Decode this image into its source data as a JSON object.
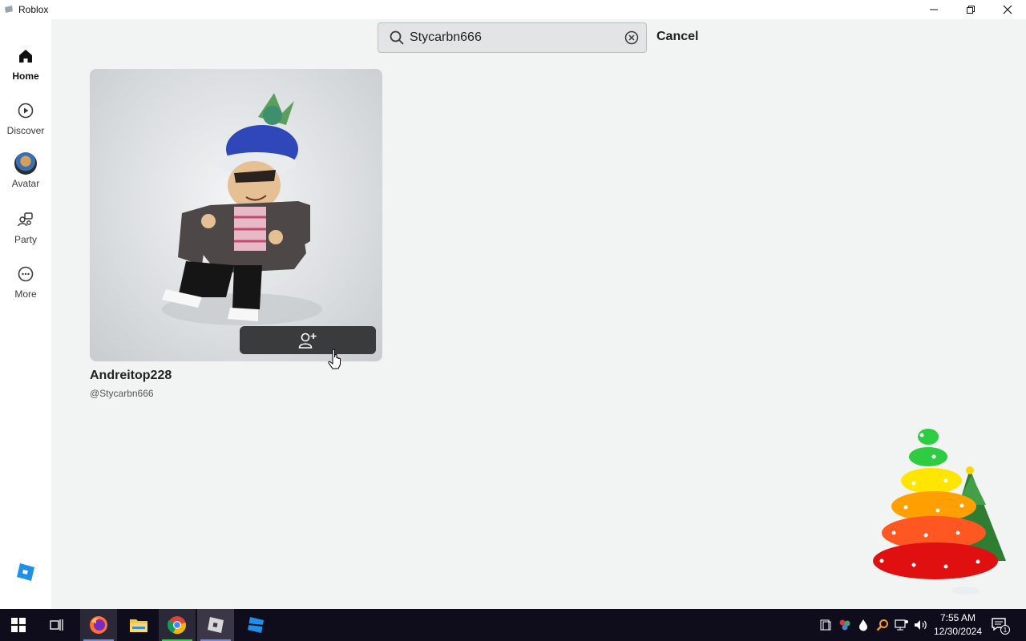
{
  "window": {
    "title": "Roblox",
    "controls": [
      "minimize",
      "restore",
      "close"
    ]
  },
  "sidebar": {
    "items": [
      {
        "label": "Home",
        "icon": "home-icon",
        "active": true
      },
      {
        "label": "Discover",
        "icon": "play-circle-icon",
        "active": false
      },
      {
        "label": "Avatar",
        "icon": "avatar-icon",
        "active": false
      },
      {
        "label": "Party",
        "icon": "party-icon",
        "active": false
      },
      {
        "label": "More",
        "icon": "more-icon",
        "active": false
      }
    ],
    "logo": "roblox-logo-icon"
  },
  "search": {
    "value": "Stycarbn666",
    "cancel_label": "Cancel"
  },
  "results": [
    {
      "display_name": "Andreitop228",
      "username": "@Stycarbn666",
      "action_icon": "add-friend-icon"
    }
  ],
  "taskbar": {
    "apps": [
      "windows-start-icon",
      "task-view-icon",
      "firefox-icon",
      "file-explorer-icon",
      "chrome-icon",
      "roblox-icon",
      "roblox-studio-icon"
    ],
    "time": "7:55 AM",
    "date": "12/30/2024",
    "notification_count": "1"
  },
  "colors": {
    "accent_dark": "#393b3d",
    "page_bg": "#f2f3f3",
    "taskbar_bg": "#0f0d1c"
  }
}
